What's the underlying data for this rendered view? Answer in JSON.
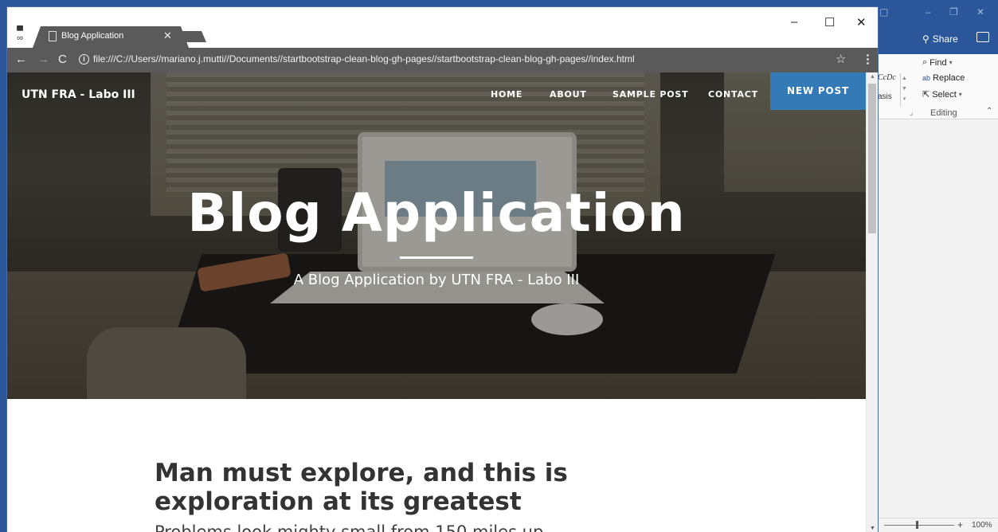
{
  "word": {
    "share_label": "Share",
    "styles": {
      "style1": "CcDc",
      "style2": "asis"
    },
    "editing": {
      "find_label": "Find",
      "replace_label": "Replace",
      "select_label": "Select",
      "group_label": "Editing"
    },
    "zoom_level": "100%"
  },
  "browser": {
    "tab_title": "Blog Application",
    "url": "file:///C://Users//mariano.j.mutti//Documents//startbootstrap-clean-blog-gh-pages//startbootstrap-clean-blog-gh-pages//index.html",
    "icons": [
      "incognito-icon",
      "page-icon",
      "close-icon",
      "back-arrow-icon",
      "forward-arrow-icon",
      "reload-icon",
      "info-icon",
      "star-icon",
      "menu-icon",
      "minimize-icon",
      "maximize-icon"
    ]
  },
  "site": {
    "brand": "UTN FRA - Labo III",
    "nav": {
      "home": "HOME",
      "about": "ABOUT",
      "sample_post": "SAMPLE POST",
      "contact": "CONTACT",
      "new_post": "NEW POST"
    },
    "hero": {
      "title": "Blog Application",
      "subtitle": "A Blog Application by UTN FRA - Labo III"
    },
    "post": {
      "title": "Man must explore, and this is exploration at its greatest",
      "subtitle": "Problems look mighty small from 150 miles up"
    }
  },
  "colors": {
    "new_post_bg": "#337ab7",
    "chrome_toolbar": "#5a5a5a",
    "word_blue": "#2b579a"
  }
}
